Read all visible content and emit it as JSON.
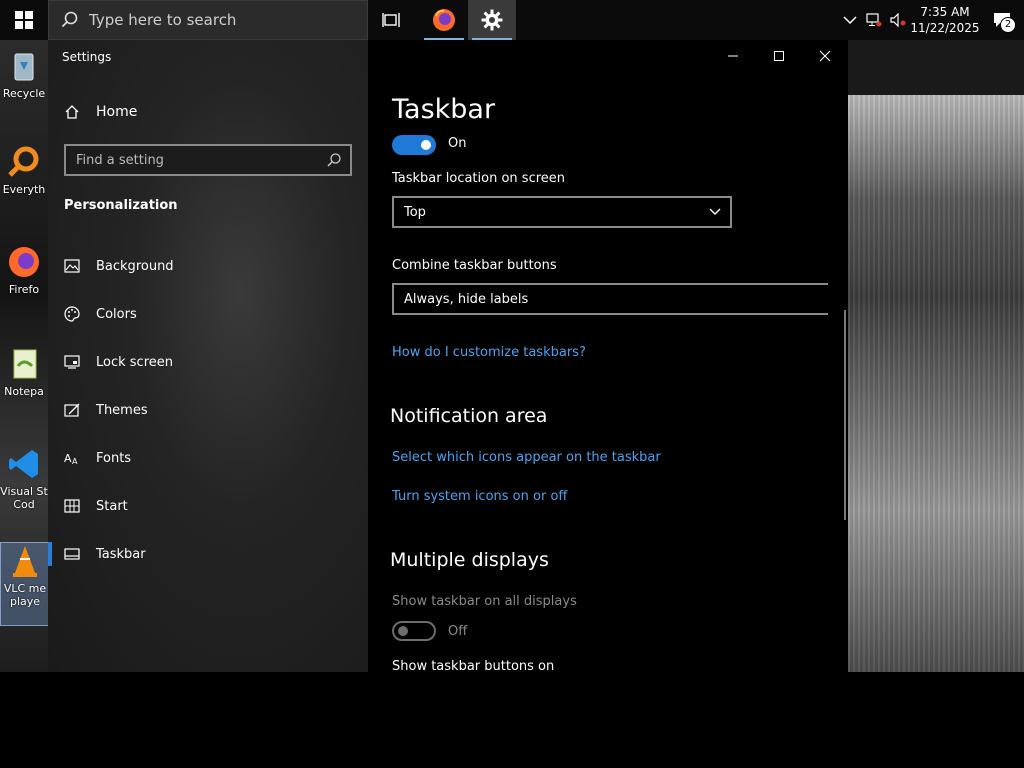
{
  "taskbar": {
    "search_placeholder": "Type here to search",
    "clock_time": "7:35 AM",
    "clock_date": "11/22/2025",
    "notifications_count": "2"
  },
  "desktop_icons": [
    {
      "label": "Recycle"
    },
    {
      "label": "Everyth"
    },
    {
      "label": "Firefo"
    },
    {
      "label": "Notepa"
    },
    {
      "label": "Visual St"
    },
    {
      "label": "Cod"
    },
    {
      "label": "VLC me"
    },
    {
      "label": "playe"
    }
  ],
  "settings": {
    "window_title": "Settings",
    "home_label": "Home",
    "find_placeholder": "Find a setting",
    "section_label": "Personalization",
    "nav": [
      {
        "label": "Background",
        "icon": "picture-icon"
      },
      {
        "label": "Colors",
        "icon": "palette-icon"
      },
      {
        "label": "Lock screen",
        "icon": "lock-screen-icon"
      },
      {
        "label": "Themes",
        "icon": "themes-icon"
      },
      {
        "label": "Fonts",
        "icon": "fonts-icon"
      },
      {
        "label": "Start",
        "icon": "start-icon"
      },
      {
        "label": "Taskbar",
        "icon": "taskbar-icon"
      }
    ],
    "selected_nav": "Taskbar"
  },
  "content": {
    "page_title": "Taskbar",
    "toggle_top_state": "On",
    "location_label": "Taskbar location on screen",
    "location_value": "Top",
    "combine_label": "Combine taskbar buttons",
    "combine_value": "Always, hide labels",
    "customize_link": "How do I customize taskbars?",
    "notification_heading": "Notification area",
    "select_icons_link": "Select which icons appear on the taskbar",
    "system_icons_link": "Turn system icons on or off",
    "multiple_heading": "Multiple displays",
    "show_all_label": "Show taskbar on all displays",
    "show_all_state": "Off",
    "show_buttons_label": "Show taskbar buttons on"
  },
  "colors": {
    "accent": "#1e7ad6",
    "link": "#4aa3f0",
    "window_bg": "#000000",
    "sidebar_bg": "#242424"
  }
}
